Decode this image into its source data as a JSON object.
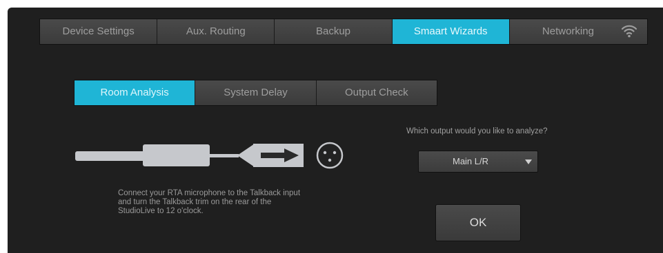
{
  "top_tabs": [
    {
      "label": "Device Settings",
      "active": false
    },
    {
      "label": "Aux. Routing",
      "active": false
    },
    {
      "label": "Backup",
      "active": false
    },
    {
      "label": "Smaart Wizards",
      "active": true
    },
    {
      "label": "Networking",
      "active": false
    }
  ],
  "sub_tabs": [
    {
      "label": "Room Analysis",
      "active": true
    },
    {
      "label": "System Delay",
      "active": false
    },
    {
      "label": "Output Check",
      "active": false
    }
  ],
  "instructions": "Connect your RTA microphone to the Talkback input and turn the Talkback trim on the rear of the StudioLive to 12 o'clock.",
  "output_question": "Which output would you like to analyze?",
  "output_select": {
    "value": "Main L/R"
  },
  "ok_button": "OK",
  "colors": {
    "accent": "#1fb5d6",
    "background": "#1f1f1f",
    "tab": "#444444",
    "text": "#9e9e9e"
  },
  "icons": {
    "networking": "wifi-icon",
    "dropdown": "caret-down-icon",
    "diagram": "rta-microphone-xlr-diagram"
  }
}
